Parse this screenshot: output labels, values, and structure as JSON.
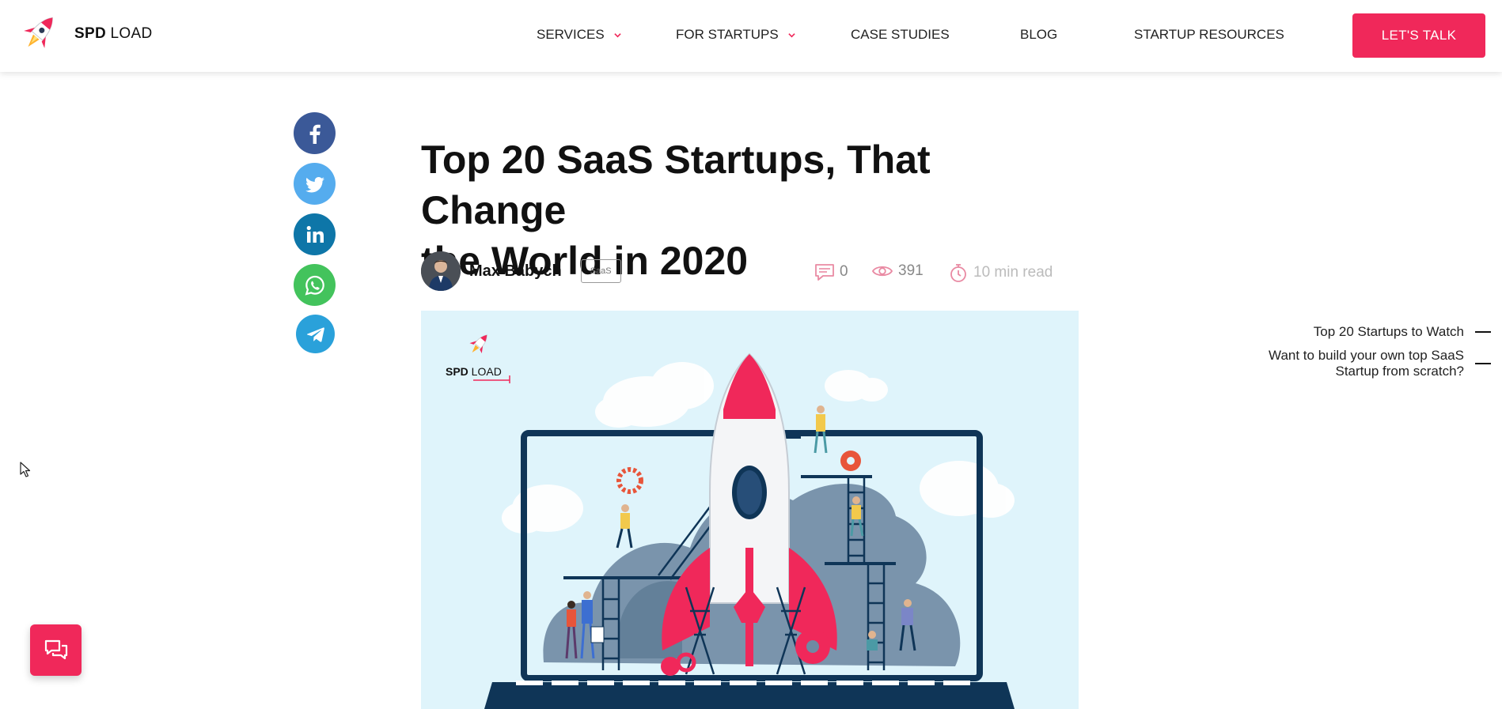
{
  "brand": {
    "bold": "SPD",
    "rest": " LOAD"
  },
  "nav": {
    "items": [
      {
        "label": "SERVICES",
        "dropdown": true
      },
      {
        "label": "FOR STARTUPS",
        "dropdown": true
      },
      {
        "label": "CASE STUDIES",
        "dropdown": false
      },
      {
        "label": "BLOG",
        "dropdown": false
      },
      {
        "label": "STARTUP RESOURCES",
        "dropdown": false
      }
    ],
    "cta_label": "LET'S TALK"
  },
  "share": [
    "facebook-icon",
    "twitter-icon",
    "linkedin-icon",
    "whatsapp-icon",
    "telegram-icon"
  ],
  "article": {
    "title_line1": "Top 20 SaaS Startups, That Change",
    "title_line2": "the World in 2020",
    "author": "Max Babych",
    "tag": "SaaS",
    "comments": "0",
    "views": "391",
    "read_time": "10 min read"
  },
  "hero": {
    "logo_bold": "SPD",
    "logo_rest": " LOAD"
  },
  "toc": {
    "items": [
      {
        "line1": "Top 20 Startups to Watch",
        "line2": ""
      },
      {
        "line1": "Want to build your own top SaaS",
        "line2": "Startup from scratch?"
      }
    ]
  },
  "colors": {
    "accent": "#f0285a",
    "facebook": "#3b5998",
    "twitter": "#55acee",
    "linkedin": "#0e76a8",
    "whatsapp": "#43c35c",
    "telegram": "#2aa1da",
    "meta_pink": "#e98aa3"
  }
}
